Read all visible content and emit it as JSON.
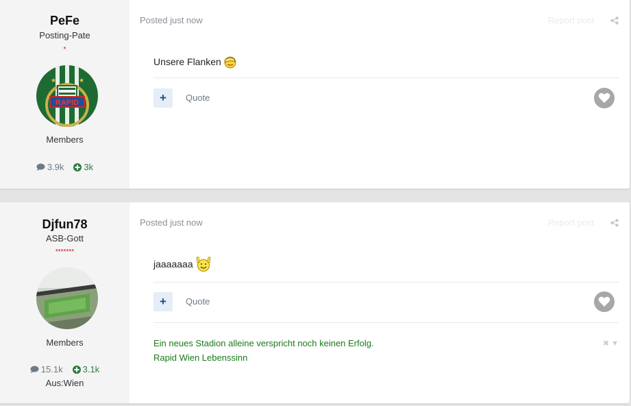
{
  "posts": [
    {
      "author": {
        "name": "PeFe",
        "title": "Posting-Pate",
        "stars": "*",
        "group": "Members",
        "posts_count": "3.9k",
        "reputation": "3k"
      },
      "posted": "Posted just now",
      "report": "Report post",
      "text": "Unsere Flanken",
      "quote": "Quote",
      "plus": "+"
    },
    {
      "author": {
        "name": "Djfun78",
        "title": "ASB-Gott",
        "stars": "*******",
        "group": "Members",
        "posts_count": "15.1k",
        "reputation": "3.1k",
        "location": "Aus:Wien"
      },
      "posted": "Posted just now",
      "report": "Report post",
      "text": "jaaaaaaa",
      "quote": "Quote",
      "plus": "+",
      "signature": [
        "Ein neues Stadion alleine verspricht noch keinen Erfolg.",
        "Rapid Wien Lebenssinn"
      ]
    }
  ],
  "colors": {
    "accent": "#204f85",
    "signature": "#1a7a1a",
    "stars": "#c0171e",
    "reputation": "#2f7b3f"
  }
}
